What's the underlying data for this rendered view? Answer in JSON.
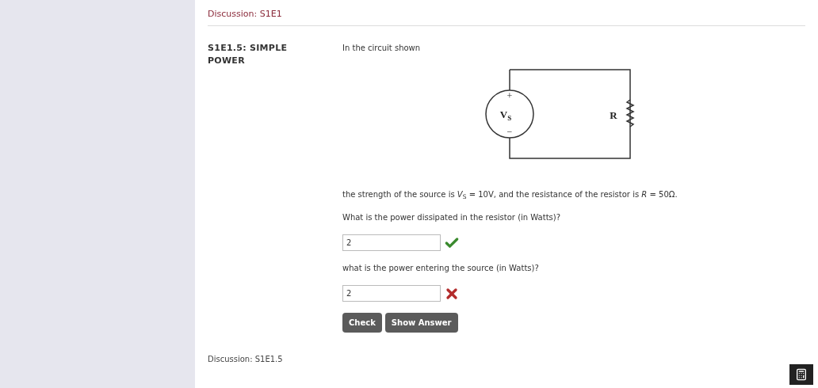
{
  "top_link": "Discussion: S1E1",
  "problem": {
    "title": "S1E1.5: SIMPLE POWER",
    "intro": "In the circuit shown",
    "circuit": {
      "plus": "+",
      "source": "V",
      "source_sub": "S",
      "minus": "−",
      "resistor": "R"
    },
    "statement": "the strength of the source is *V*$_{S}$ = 10V, and the resistance of the resistor is *R* = 50Ω.",
    "questions": [
      {
        "prompt": "What is the power dissipated in the resistor (in Watts)?",
        "value": "2",
        "correct": true
      },
      {
        "prompt": "what is the power entering the source (in Watts)?",
        "value": "2",
        "correct": false
      }
    ],
    "buttons": [
      "Check",
      "Show Answer"
    ]
  },
  "bottom_link": "Discussion: S1E1.5"
}
